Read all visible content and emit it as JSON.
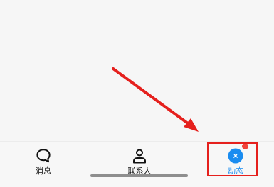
{
  "tab_bar": {
    "tabs": [
      {
        "label": "消息",
        "icon": "chat-bubble-icon",
        "active": false
      },
      {
        "label": "联系人",
        "icon": "person-icon",
        "active": false
      },
      {
        "label": "动态",
        "icon": "moments-icon",
        "active": true
      }
    ],
    "badge": "red-dot",
    "active_color": "#1a8cf0",
    "inactive_color": "#111111"
  },
  "annotation": {
    "arrow_color": "#e5201d",
    "highlight_color": "#e5201d"
  }
}
